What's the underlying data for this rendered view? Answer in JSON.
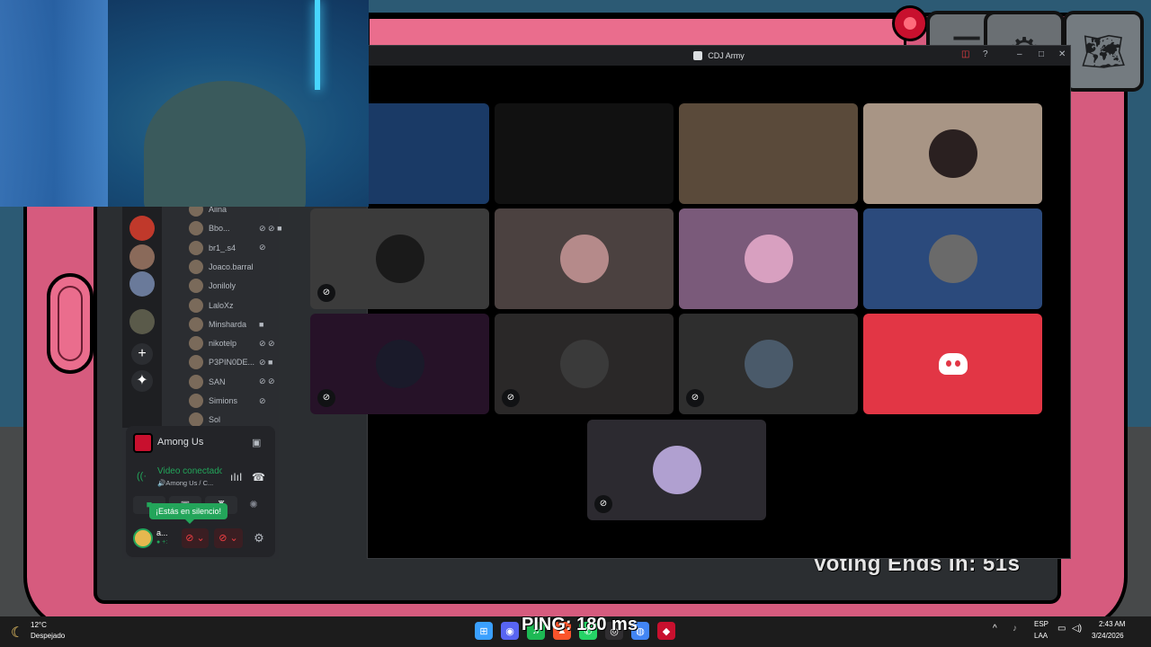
{
  "game": {
    "voting_text": "Voting Ends In: 51s",
    "ping_text": "PING: 180 ms"
  },
  "call_window": {
    "title": "CDJ Army",
    "tiles": [
      {
        "type": "video",
        "color": "#1a3a66",
        "muted": false
      },
      {
        "type": "video",
        "color": "#111111",
        "muted": false
      },
      {
        "type": "video",
        "color": "#5a4a3a",
        "muted": false
      },
      {
        "type": "avatar",
        "color": "#a89585",
        "avatar": "#2a2020",
        "muted": false
      },
      {
        "type": "avatar",
        "color": "#3b3b3b",
        "avatar": "#1a1a1a",
        "muted": true,
        "mute_icon": "mic-off-icon"
      },
      {
        "type": "avatar",
        "color": "#4b4140",
        "avatar": "#b58a8a",
        "muted": false
      },
      {
        "type": "avatar",
        "color": "#7a5a7a",
        "avatar": "#d8a0c0",
        "muted": false
      },
      {
        "type": "avatar",
        "color": "#2b4a7c",
        "avatar": "#6a6a6a",
        "muted": false
      },
      {
        "type": "avatar",
        "color": "#261228",
        "avatar": "#1a1a2a",
        "muted": true,
        "mute_icon": "deafen-icon"
      },
      {
        "type": "avatar",
        "color": "#2a2828",
        "avatar": "#3a3a3a",
        "muted": true,
        "mute_icon": "deafen-icon"
      },
      {
        "type": "avatar",
        "color": "#2e2e2e",
        "avatar": "#4a5a6a",
        "muted": true,
        "mute_icon": "mic-off-icon"
      },
      {
        "type": "discord",
        "color": "#e23645",
        "muted": false
      },
      {
        "type": "avatar",
        "color": "#2c2a30",
        "avatar": "#b0a0d0",
        "muted": true,
        "mute_icon": "mic-off-icon"
      }
    ]
  },
  "sidebar": {
    "voice_users": [
      {
        "name": "Aiina",
        "icons": ""
      },
      {
        "name": "Bbo...",
        "icons": "⊘ ⊘ ■"
      },
      {
        "name": "br1_.s4",
        "icons": "⊘"
      },
      {
        "name": "Joaco.barral",
        "icons": ""
      },
      {
        "name": "Joniloly",
        "icons": ""
      },
      {
        "name": "LaloXz",
        "icons": ""
      },
      {
        "name": "Minsharda",
        "icons": "■"
      },
      {
        "name": "nikotelp",
        "icons": "⊘ ⊘"
      },
      {
        "name": "P3PIN0DE...",
        "icons": "⊘ ■"
      },
      {
        "name": "SAN",
        "icons": "⊘ ⊘"
      },
      {
        "name": "Simions",
        "icons": "⊘"
      },
      {
        "name": "Sol",
        "icons": ""
      }
    ],
    "activity": "Among Us",
    "voice_status": "Video conectado",
    "voice_channel": "🔊Among Us / C...",
    "mute_tooltip": "¡Estás en silencio!",
    "self_name": "a...",
    "self_status": "● +:"
  },
  "taskbar": {
    "weather_temp": "12°C",
    "weather_desc": "Despejado",
    "lang_1": "ESP",
    "lang_2": "LAA",
    "time": "2:43 AM",
    "date": "3/24/2026",
    "apps": [
      {
        "name": "windows-start",
        "color": "#3aa0ff",
        "glyph": "⊞"
      },
      {
        "name": "discord-app",
        "color": "#5865f2",
        "glyph": "◉"
      },
      {
        "name": "spotify-app",
        "color": "#1db954",
        "glyph": "♫"
      },
      {
        "name": "brave-app",
        "color": "#fb542b",
        "glyph": "▲"
      },
      {
        "name": "whatsapp-app",
        "color": "#25d366",
        "glyph": "✆"
      },
      {
        "name": "obs-app",
        "color": "#302e31",
        "glyph": "◎"
      },
      {
        "name": "chrome-app",
        "color": "#4285f4",
        "glyph": "◍"
      },
      {
        "name": "among-us-app",
        "color": "#c8102e",
        "glyph": "◆"
      }
    ]
  }
}
